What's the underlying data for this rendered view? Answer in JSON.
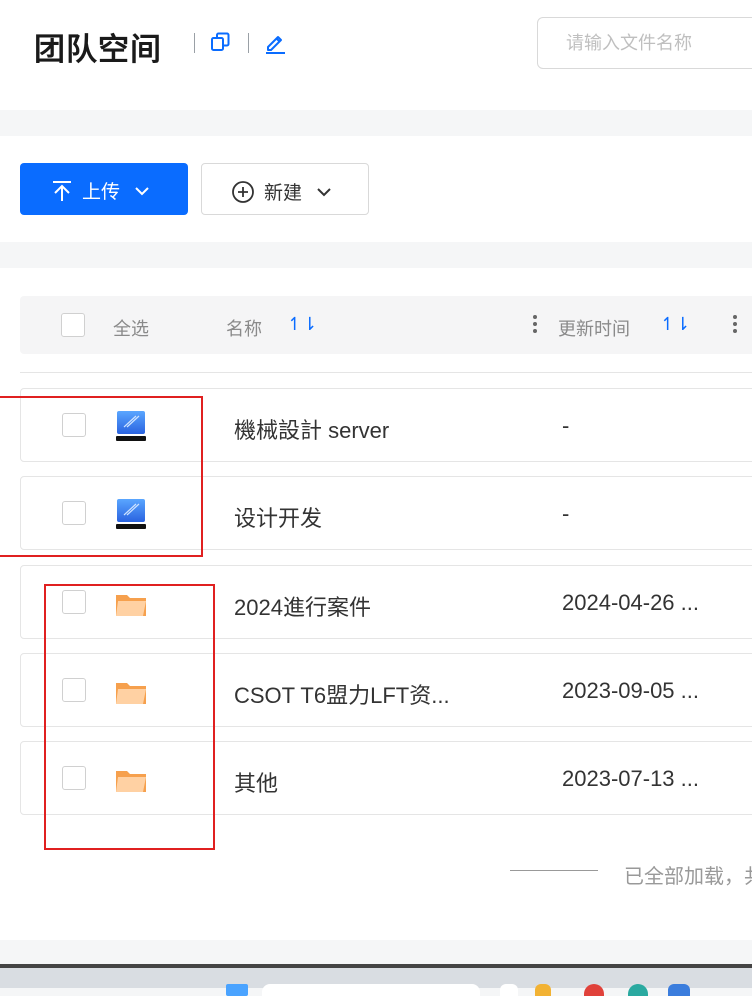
{
  "header": {
    "title": "团队空间",
    "search_placeholder": "请输入文件名称"
  },
  "toolbar": {
    "upload_label": "上传",
    "new_label": "新建"
  },
  "table": {
    "select_all": "全选",
    "col_name": "名称",
    "col_updated": "更新时间",
    "sort_glyph": "↿⇂",
    "rows": [
      {
        "name": "機械設計 server",
        "updated": "-",
        "type": "drive-icon"
      },
      {
        "name": "设计开发",
        "updated": "-",
        "type": "drive-icon"
      },
      {
        "name": "2024進行案件",
        "updated": "2024-04-26 ...",
        "type": "folder-icon"
      },
      {
        "name": "CSOT T6盟力LFT资...",
        "updated": "2023-09-05 ...",
        "type": "folder-icon"
      },
      {
        "name": "其他",
        "updated": "2023-07-13 ...",
        "type": "folder-icon"
      }
    ]
  },
  "footer": {
    "status": "已全部加载，共"
  },
  "colors": {
    "accent": "#0a6cff",
    "annotation": "#e02020",
    "folder": "#f6a04d"
  }
}
